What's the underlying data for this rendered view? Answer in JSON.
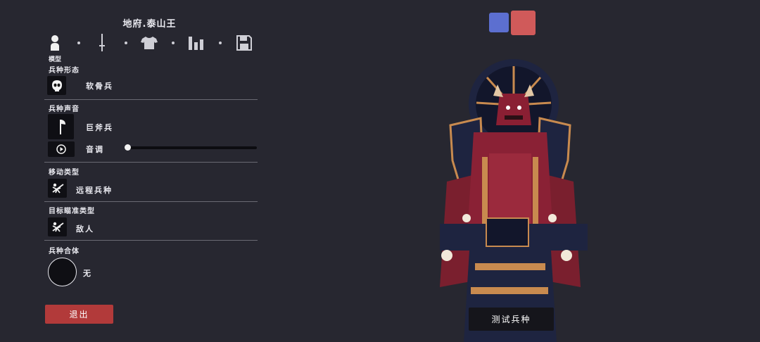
{
  "unit_title": "地府.泰山王",
  "tabs": [
    {
      "name": "model-tab",
      "icon": "person-icon",
      "label": "模型"
    },
    {
      "name": "weapon-tab",
      "icon": "sword-icon"
    },
    {
      "name": "clothing-tab",
      "icon": "shirt-icon"
    },
    {
      "name": "stats-tab",
      "icon": "bar-chart-icon"
    },
    {
      "name": "save-tab",
      "icon": "floppy-disk-icon"
    }
  ],
  "sections": {
    "form": {
      "label": "兵种形态",
      "value": "软骨兵",
      "icon": "skull-mask-icon"
    },
    "voice": {
      "label": "兵种声音",
      "value": "巨斧兵",
      "icon": "axe-icon",
      "pitch_label": "音调",
      "pitch_level": 0
    },
    "movement": {
      "label": "移动类型",
      "value": "远程兵种",
      "icon": "crouching-figure-icon"
    },
    "targeting": {
      "label": "目标瞄准类型",
      "value": "敌人",
      "icon": "crouching-figure-icon"
    },
    "merge": {
      "label": "兵种合体",
      "value": "无"
    }
  },
  "buttons": {
    "exit": "退出",
    "test_unit": "测试兵种"
  },
  "colors": {
    "team_blue": "#5c6fd0",
    "team_red": "#d05a5a",
    "exit_button": "#b23a3a",
    "background": "#272730"
  }
}
